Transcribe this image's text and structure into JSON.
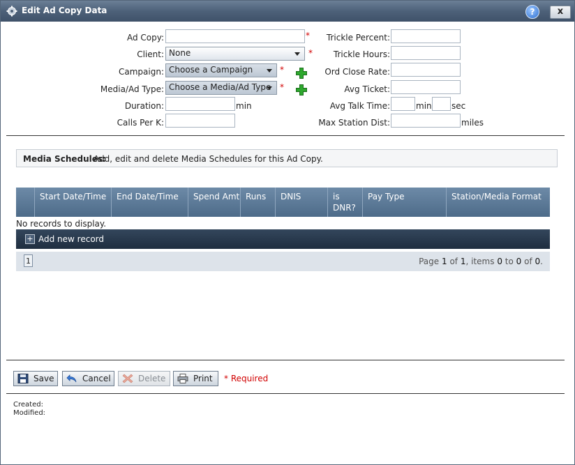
{
  "window": {
    "title": "Edit Ad Copy Data",
    "help_label": "?",
    "close_label": "x"
  },
  "form": {
    "ad_copy": {
      "label": "Ad Copy:",
      "value": "",
      "required": "*"
    },
    "client": {
      "label": "Client:",
      "value": "None",
      "required": "*"
    },
    "campaign": {
      "label": "Campaign:",
      "value": "Choose a Campaign",
      "required": "*"
    },
    "media_type": {
      "label": "Media/Ad Type:",
      "value": "Choose a Media/Ad Type",
      "required": "*"
    },
    "duration": {
      "label": "Duration:",
      "value": "",
      "unit": "min"
    },
    "calls_per_k": {
      "label": "Calls Per K:",
      "value": ""
    },
    "trickle_percent": {
      "label": "Trickle Percent:",
      "value": ""
    },
    "trickle_hours": {
      "label": "Trickle Hours:",
      "value": ""
    },
    "ord_close_rate": {
      "label": "Ord Close Rate:",
      "value": ""
    },
    "avg_ticket": {
      "label": "Avg Ticket:",
      "value": ""
    },
    "avg_talk_time": {
      "label": "Avg Talk Time:",
      "min_value": "",
      "min_unit": "min",
      "sec_value": "",
      "sec_unit": "sec"
    },
    "max_station_dist": {
      "label": "Max Station Dist:",
      "value": "",
      "unit": "miles"
    }
  },
  "schedules": {
    "heading": "Media Schedules:",
    "description": "Add, edit and delete Media Schedules for this Ad Copy.",
    "columns": [
      "Start Date/Time",
      "End Date/Time",
      "Spend Amt",
      "Runs",
      "DNIS",
      "is DNR?",
      "Pay Type",
      "Station/Media Format"
    ],
    "empty_text": "No records to display.",
    "add_label": "Add new record",
    "add_glyph": "+",
    "pager": {
      "page_button": "1",
      "t_page": "Page",
      "page": "1",
      "t_of": "of",
      "pages": "1",
      "t_items": ", items",
      "from": "0",
      "t_to": "to",
      "to": "0",
      "t_of2": "of",
      "total": "0",
      "t_end": "."
    }
  },
  "actions": {
    "save": "Save",
    "cancel": "Cancel",
    "delete": "Delete",
    "print": "Print",
    "required_note": "* Required"
  },
  "footer": {
    "created": "Created:",
    "modified": "Modified:"
  },
  "colors": {
    "titlebar": "#4d6179",
    "grid_header": "#5d7a98",
    "required": "#d10000",
    "plus_green": "#2ea82e"
  }
}
